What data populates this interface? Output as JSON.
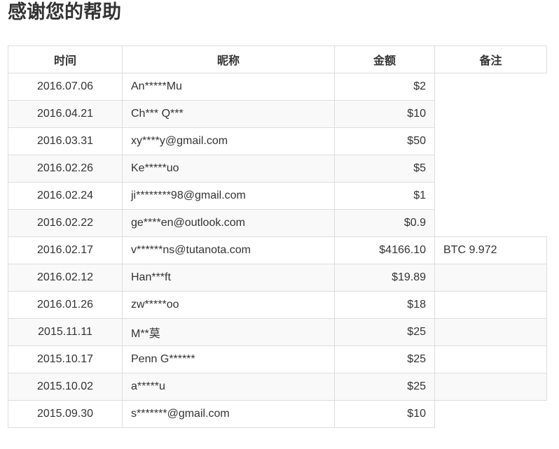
{
  "page": {
    "title": "感谢您的帮助"
  },
  "table": {
    "headers": {
      "date": "时间",
      "name": "昵称",
      "amount": "金额",
      "note": "备注"
    },
    "rows": [
      {
        "date": "2016.07.06",
        "name": "An*****Mu",
        "amount": "$2",
        "note": ""
      },
      {
        "date": "2016.04.21",
        "name": "Ch*** Q***",
        "amount": "$10",
        "note": ""
      },
      {
        "date": "2016.03.31",
        "name": "xy****y@gmail.com",
        "amount": "$50",
        "note": ""
      },
      {
        "date": "2016.02.26",
        "name": "Ke*****uo",
        "amount": "$5",
        "note": ""
      },
      {
        "date": "2016.02.24",
        "name": "ji********98@gmail.com",
        "amount": "$1",
        "note": ""
      },
      {
        "date": "2016.02.22",
        "name": "ge****en@outlook.com",
        "amount": "$0.9",
        "note": ""
      },
      {
        "date": "2016.02.17",
        "name": "v******ns@tutanota.com",
        "amount": "$4166.10",
        "note": "BTC 9.972"
      },
      {
        "date": "2016.02.12",
        "name": "Han***ft",
        "amount": "$19.89",
        "note": ""
      },
      {
        "date": "2016.01.26",
        "name": "zw*****oo",
        "amount": "$18",
        "note": ""
      },
      {
        "date": "2015.11.11",
        "name": "M**莫",
        "amount": "$25",
        "note": ""
      },
      {
        "date": "2015.10.17",
        "name": "Penn G******",
        "amount": "$25",
        "note": ""
      },
      {
        "date": "2015.10.02",
        "name": "a*****u",
        "amount": "$25",
        "note": ""
      },
      {
        "date": "2015.09.30",
        "name": "s*******@gmail.com",
        "amount": "$10",
        "note": ""
      }
    ]
  }
}
